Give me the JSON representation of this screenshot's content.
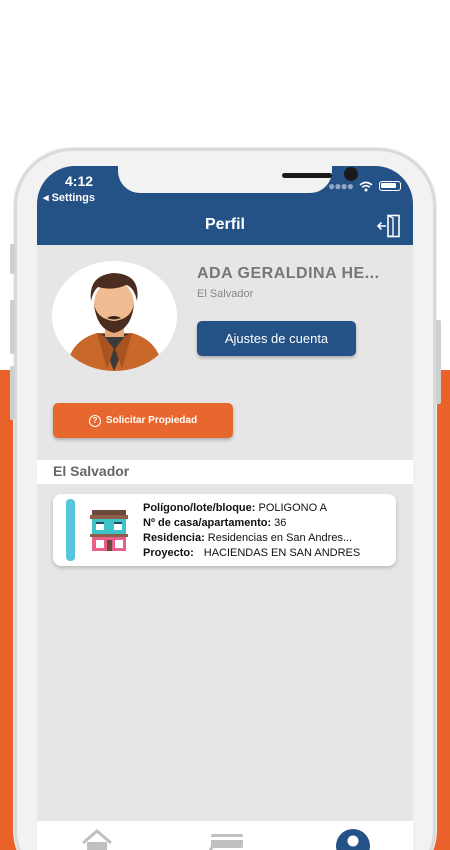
{
  "status_bar": {
    "time": "4:12",
    "back_label": "◂ Settings",
    "signal_dots": "●●●●"
  },
  "header": {
    "title": "Perfil"
  },
  "profile": {
    "name": "ADA GERALDINA HE...",
    "country": "El Salvador",
    "account_settings_label": "Ajustes de cuenta",
    "request_property_label": "Solicitar Propiedad"
  },
  "section": {
    "title": "El Salvador"
  },
  "property_card": {
    "poligono_label": "Polígono/lote/bloque:",
    "poligono_value": " POLIGONO A",
    "casa_label": "Nº de casa/apartamento:",
    "casa_value": " 36",
    "residencia_label": "Residencia:",
    "residencia_value": " Residencias en San Andres...",
    "proyecto_label": "Proyecto:",
    "proyecto_value": "HACIENDAS EN SAN ANDRES"
  },
  "tabbar": {
    "items": [
      "home-icon",
      "card-icon",
      "profile-icon"
    ],
    "active": "profile-icon"
  },
  "colors": {
    "brand_blue": "#245186",
    "accent_orange": "#e8672e",
    "card_accent": "#58c6da",
    "screen_bg": "#e6e6e6"
  }
}
